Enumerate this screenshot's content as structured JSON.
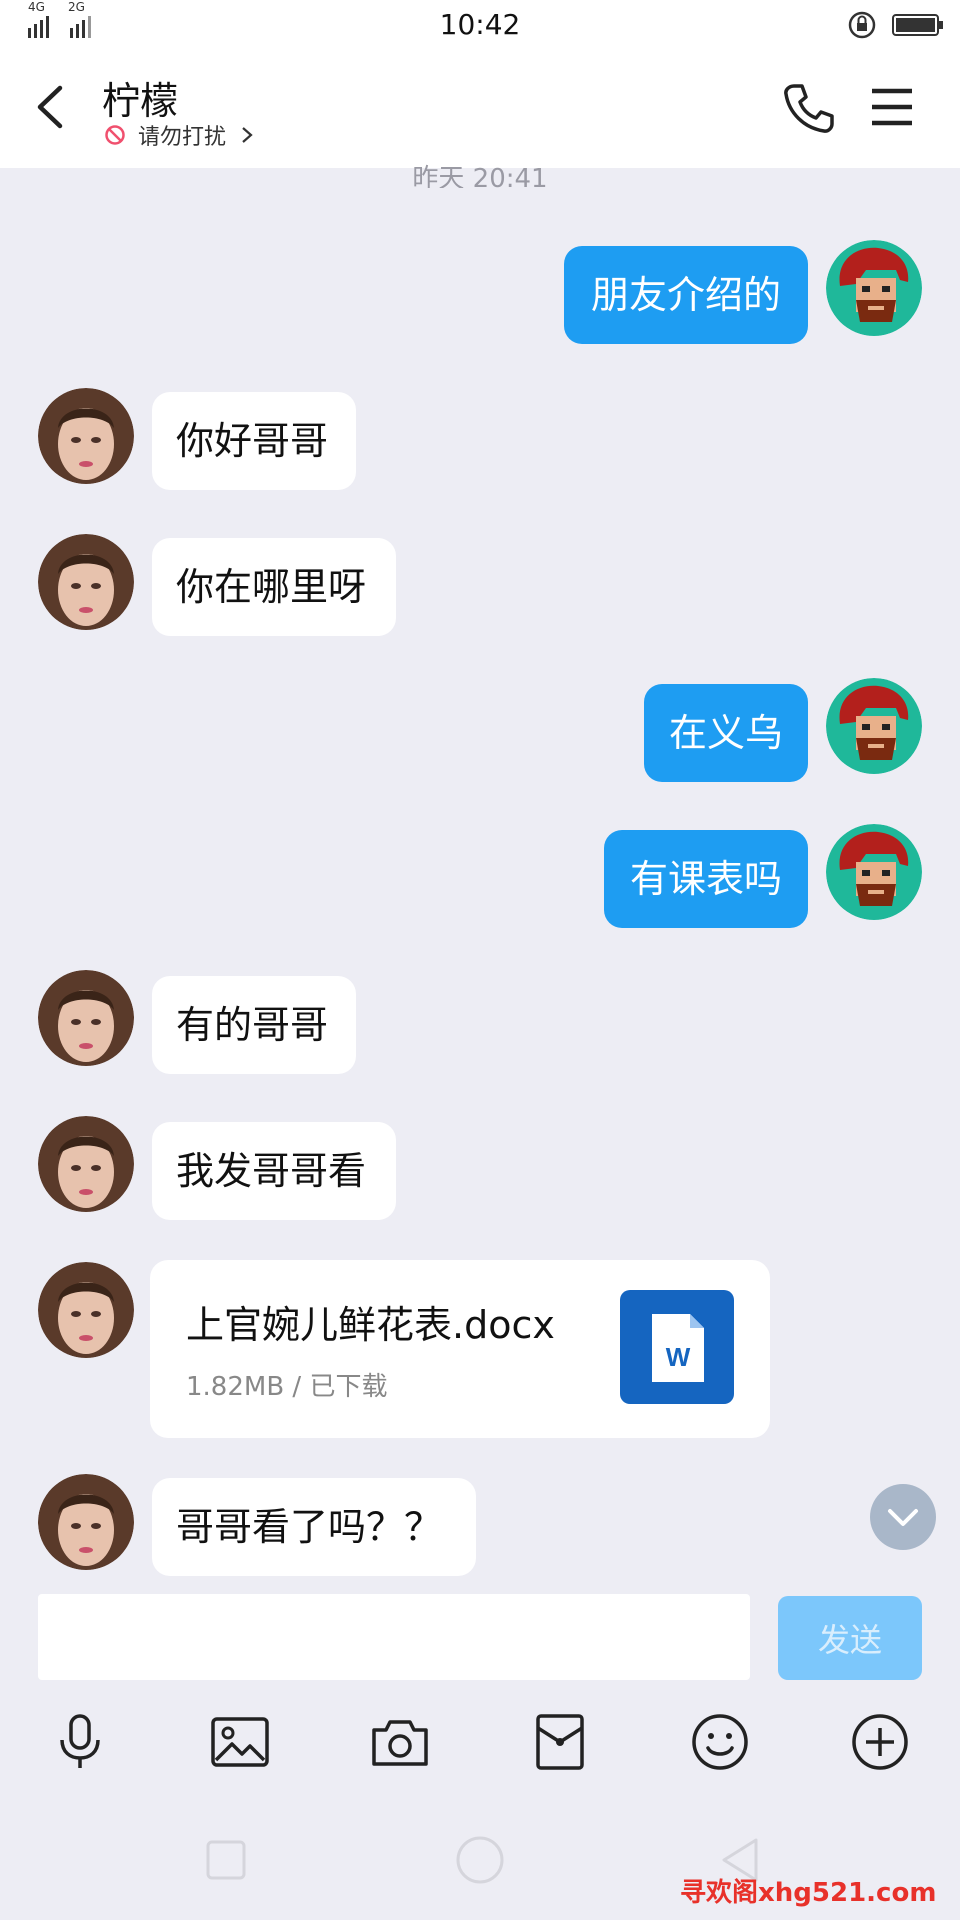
{
  "status_bar": {
    "signal_1": "4G",
    "signal_2": "2G",
    "time": "10:42"
  },
  "header": {
    "contact_name": "柠檬",
    "status_text": "请勿打扰"
  },
  "timestamp": "昨天 20:41",
  "messages": [
    {
      "direction": "out",
      "text": "朋友介绍的"
    },
    {
      "direction": "in",
      "text": "你好哥哥"
    },
    {
      "direction": "in",
      "text": "你在哪里呀"
    },
    {
      "direction": "out",
      "text": "在义乌"
    },
    {
      "direction": "out",
      "text": "有课表吗"
    },
    {
      "direction": "in",
      "text": "有的哥哥"
    },
    {
      "direction": "in",
      "text": "我发哥哥看"
    },
    {
      "direction": "in",
      "type": "file",
      "file_name": "上官婉儿鲜花表.docx",
      "file_meta": "1.82MB / 已下载",
      "file_icon_letter": "W"
    },
    {
      "direction": "in",
      "text": "哥哥看了吗？？"
    }
  ],
  "input": {
    "value": "",
    "send_label": "发送"
  },
  "toolbar": [
    "mic-icon",
    "image-icon",
    "camera-icon",
    "red-packet-icon",
    "emoji-icon",
    "plus-icon"
  ],
  "watermark": "寻欢阁xhg521.com",
  "colors": {
    "outgoing_bubble": "#1e9df2",
    "send_button": "#7cc7fb",
    "background": "#ededf4"
  }
}
